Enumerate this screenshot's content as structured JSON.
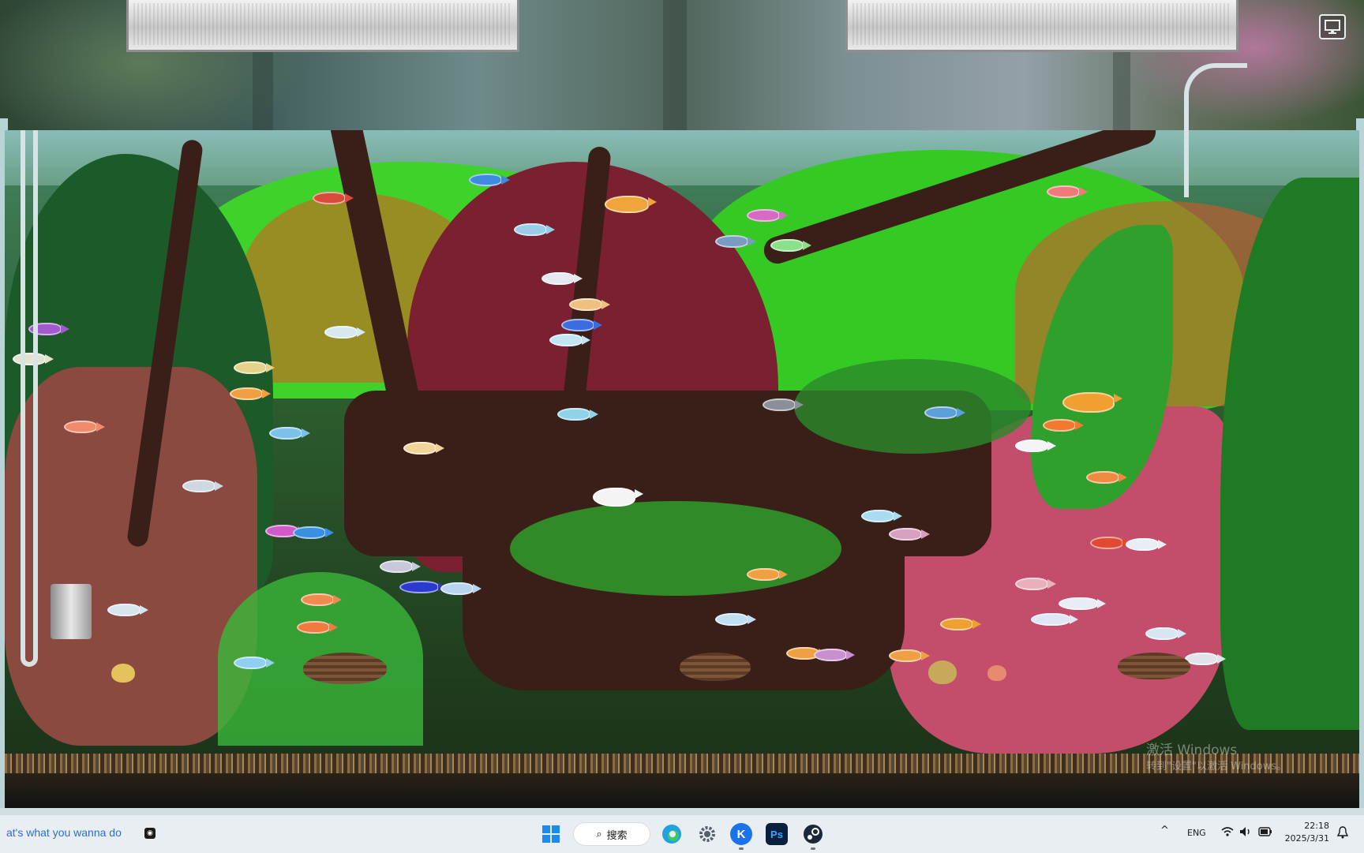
{
  "wallpaper": {
    "watermark_line1": "激活 Windows",
    "watermark_line2": "转到\"设置\"以激活 Windows。"
  },
  "corner_button": {
    "icon": "display-icon"
  },
  "taskbar": {
    "media_text": "at's what you wanna do",
    "search_label": "搜索",
    "apps": [
      {
        "name": "start",
        "icon": "windows-logo-icon"
      },
      {
        "name": "edge",
        "icon": "edge-icon"
      },
      {
        "name": "settings",
        "icon": "gear-icon"
      },
      {
        "name": "kugou",
        "icon": "kugou-icon",
        "label": "K"
      },
      {
        "name": "photoshop",
        "icon": "photoshop-icon",
        "label": "Ps"
      },
      {
        "name": "steam",
        "icon": "steam-icon"
      }
    ],
    "tray": {
      "language": "ENG",
      "time": "22:18",
      "date": "2025/3/31"
    }
  },
  "colors": {
    "taskbar_bg": "#e9eef3",
    "accent_blue": "#2b6fd6",
    "photoshop_bg": "#0a1f3d",
    "photoshop_fg": "#31a8ff",
    "kugou_bg": "#1a73e8"
  }
}
